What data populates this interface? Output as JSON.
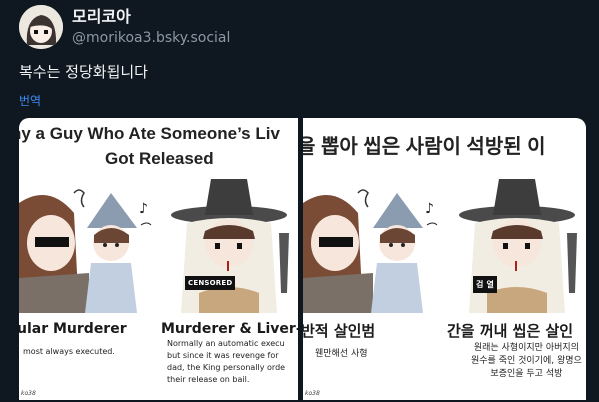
{
  "post": {
    "display_name": "모리코아",
    "handle": "@morikoa3.bsky.social",
    "text": "복수는 정당화됩니다",
    "translate_label": "번역"
  },
  "images": [
    {
      "title_line1": "hy a Guy Who Ate Someone’s Liv",
      "title_line2": "Got Released",
      "label_left": "ular Murderer",
      "desc_left": "most always executed.",
      "label_right": "Murderer & Liver-E",
      "badge": "CENSORED",
      "desc_right": [
        "Normally an automatic execu",
        "but since it was revenge for",
        "dad, the King personally orde",
        "their release on bail."
      ],
      "signature": "ko38"
    },
    {
      "title_line1": "을 뽑아 씹은 사람이 석방된 이",
      "label_left": "반적 살인범",
      "desc_left": "웬만해선 사형",
      "label_right": "간을 꺼내 씹은 살인",
      "badge": "검 열",
      "desc_right": [
        "원래는 사형이지만 아버지의",
        "원수를 죽인 것이기에, 왕명으",
        "보증인을 두고 석방"
      ],
      "signature": "ko38"
    }
  ],
  "colors": {
    "background": "#0f1720",
    "link": "#3d8cf4",
    "handle": "#8b98a5"
  }
}
